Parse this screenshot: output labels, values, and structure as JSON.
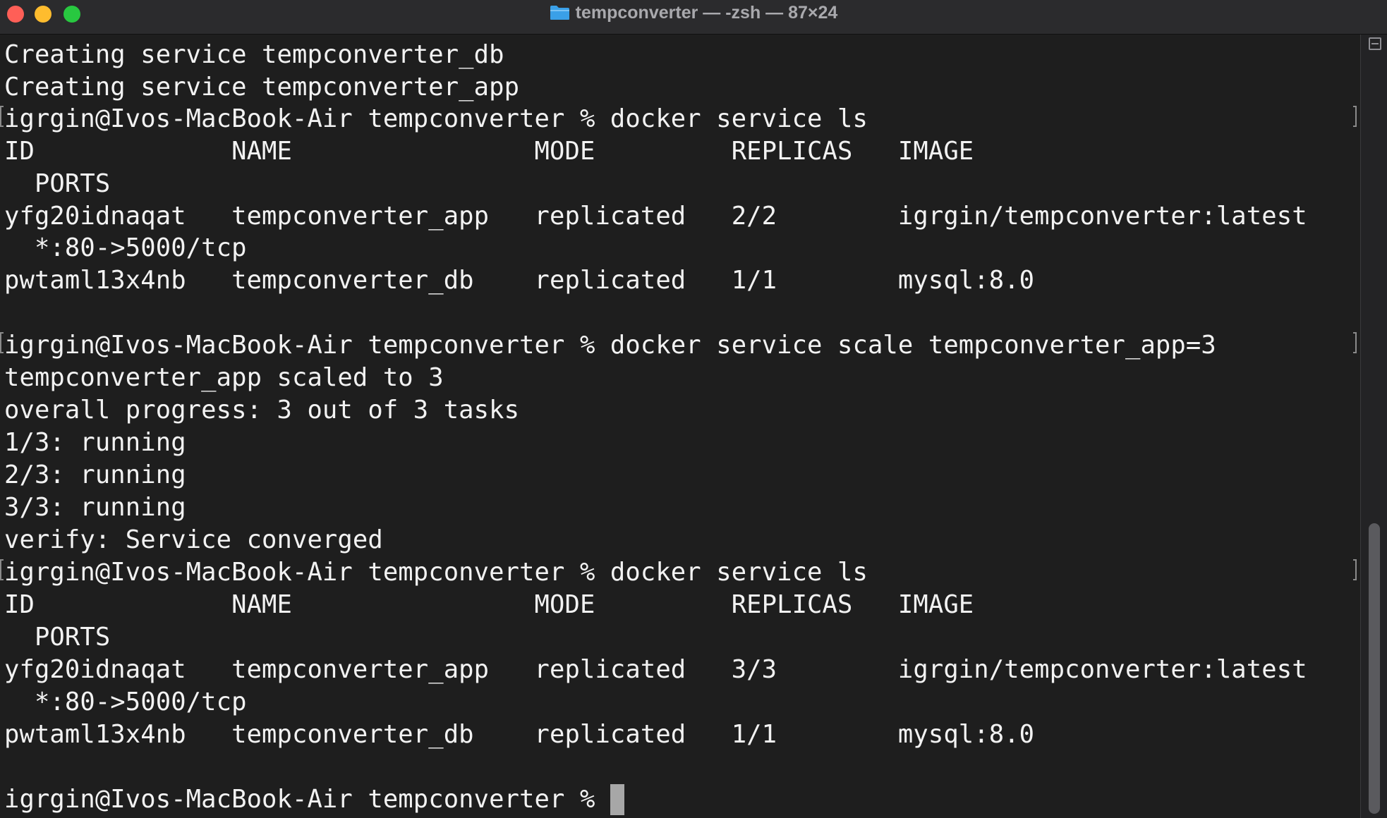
{
  "window": {
    "title": "tempconverter — -zsh — 87×24",
    "icon": "folder-icon"
  },
  "terminal": {
    "lines": [
      "Creating service tempconverter_db",
      "Creating service tempconverter_app",
      "igrgin@Ivos-MacBook-Air tempconverter % docker service ls",
      "ID             NAME                MODE         REPLICAS   IMAGE",
      "  PORTS",
      "yfg20idnaqat   tempconverter_app   replicated   2/2        igrgin/tempconverter:latest",
      "  *:80->5000/tcp",
      "pwtaml13x4nb   tempconverter_db    replicated   1/1        mysql:8.0",
      "",
      "igrgin@Ivos-MacBook-Air tempconverter % docker service scale tempconverter_app=3",
      "tempconverter_app scaled to 3",
      "overall progress: 3 out of 3 tasks",
      "1/3: running",
      "2/3: running",
      "3/3: running",
      "verify: Service converged",
      "igrgin@Ivos-MacBook-Air tempconverter % docker service ls",
      "ID             NAME                MODE         REPLICAS   IMAGE",
      "  PORTS",
      "yfg20idnaqat   tempconverter_app   replicated   3/3        igrgin/tempconverter:latest",
      "  *:80->5000/tcp",
      "pwtaml13x4nb   tempconverter_db    replicated   1/1        mysql:8.0",
      "",
      "igrgin@Ivos-MacBook-Air tempconverter % "
    ]
  },
  "colors": {
    "background": "#1e1e1e",
    "text": "#f2f2f2",
    "titlebar": "#2b2b2d",
    "close": "#ff5f57",
    "minimize": "#febc2e",
    "maximize": "#28c840",
    "folder": "#3aa0e8"
  }
}
